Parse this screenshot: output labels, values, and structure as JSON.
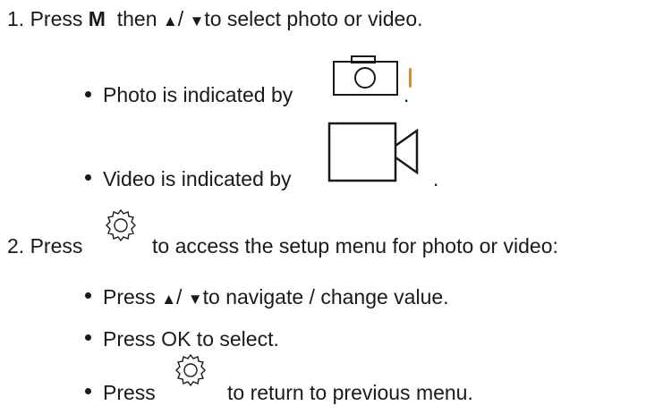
{
  "steps": [
    {
      "number": "1.",
      "prefix": "Press",
      "mode_key": "M",
      "middle": "then",
      "up_arrow": "▲",
      "separator": "/",
      "down_arrow": "▼",
      "suffix": "to select photo or video.",
      "bullets": [
        {
          "text": "Photo is indicated by",
          "icon": "camera-icon",
          "end": "."
        },
        {
          "text": "Video is indicated by",
          "icon": "video-camera-icon",
          "end": "."
        }
      ]
    },
    {
      "number": "2.",
      "prefix": "Press",
      "icon": "settings-gear-icon",
      "suffix": "to access the setup menu for photo or video:",
      "bullets": [
        {
          "prefix": "Press",
          "up_arrow": "▲",
          "separator": "/",
          "down_arrow": "▼",
          "text": "to navigate / change value."
        },
        {
          "text": "Press OK to select."
        },
        {
          "prefix": "Press",
          "icon": "settings-gear-icon",
          "text": "to return to previous menu."
        }
      ]
    }
  ]
}
